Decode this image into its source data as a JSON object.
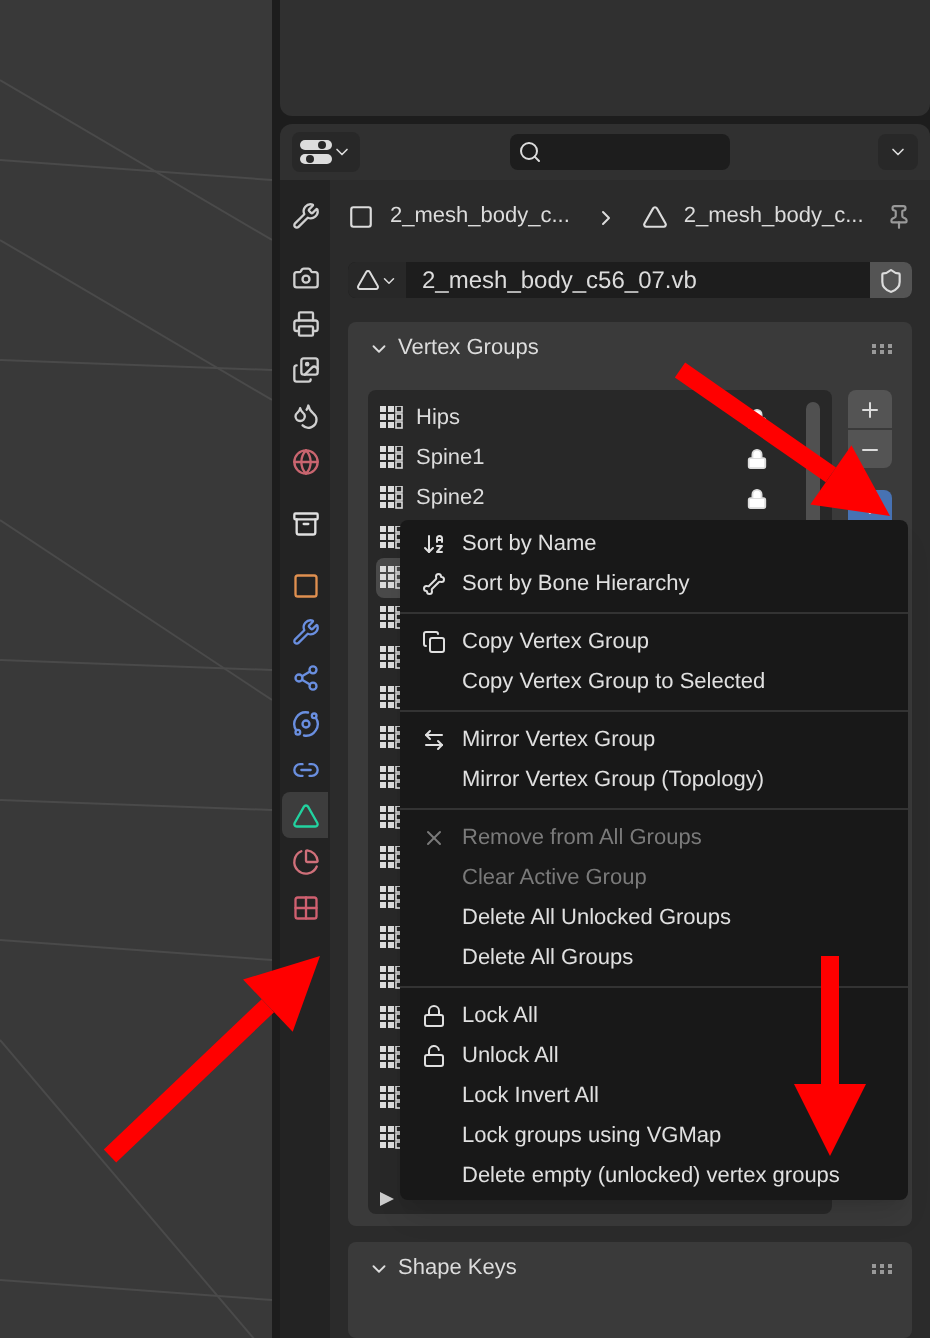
{
  "tabs": [
    {
      "kind": "tool",
      "selected": false
    },
    {
      "kind": "render",
      "selected": false
    },
    {
      "kind": "output",
      "selected": false
    },
    {
      "kind": "view_layer",
      "selected": false
    },
    {
      "kind": "scene",
      "selected": false
    },
    {
      "kind": "world",
      "selected": false
    },
    {
      "kind": "collection",
      "selected": false
    },
    {
      "kind": "object",
      "selected": false
    },
    {
      "kind": "modifiers",
      "selected": false
    },
    {
      "kind": "particles",
      "selected": false
    },
    {
      "kind": "physics",
      "selected": false
    },
    {
      "kind": "constraints",
      "selected": false
    },
    {
      "kind": "data",
      "selected": true
    },
    {
      "kind": "material",
      "selected": false
    },
    {
      "kind": "texture",
      "selected": false
    }
  ],
  "breadcrumb": [
    {
      "kind": "object",
      "label": "2_mesh_body_c..."
    },
    {
      "kind": "mesh",
      "label": "2_mesh_body_c..."
    }
  ],
  "mesh_name": "2_mesh_body_c56_07.vb",
  "vertex_groups": {
    "title": "Vertex Groups",
    "items": [
      {
        "name": "Hips",
        "locked": true
      },
      {
        "name": "Spine1",
        "locked": true
      },
      {
        "name": "Spine2",
        "locked": true
      }
    ],
    "covered_rows": [
      {
        "selected": false
      },
      {
        "selected": true
      },
      {
        "selected": false
      },
      {
        "selected": false
      },
      {
        "selected": false
      },
      {
        "selected": false
      },
      {
        "selected": false
      },
      {
        "selected": false
      },
      {
        "selected": false
      },
      {
        "selected": false
      },
      {
        "selected": false
      },
      {
        "selected": false
      },
      {
        "selected": false
      },
      {
        "selected": false
      },
      {
        "selected": false
      },
      {
        "selected": false
      }
    ],
    "menu": [
      [
        {
          "label": "Sort by Name",
          "disabled": false
        },
        {
          "label": "Sort by Bone Hierarchy",
          "disabled": false
        }
      ],
      [
        {
          "label": "Copy Vertex Group",
          "disabled": false
        },
        {
          "label": "Copy Vertex Group to Selected",
          "disabled": false
        }
      ],
      [
        {
          "label": "Mirror Vertex Group",
          "disabled": false
        },
        {
          "label": "Mirror Vertex Group (Topology)",
          "disabled": false
        }
      ],
      [
        {
          "label": "Remove from All Groups",
          "disabled": true
        },
        {
          "label": "Clear Active Group",
          "disabled": true
        },
        {
          "label": "Delete All Unlocked Groups",
          "disabled": false
        },
        {
          "label": "Delete All Groups",
          "disabled": false
        }
      ],
      [
        {
          "label": "Lock All",
          "disabled": false
        },
        {
          "label": "Unlock All",
          "disabled": false
        },
        {
          "label": "Lock Invert All",
          "disabled": false
        },
        {
          "label": "Lock groups using VGMap",
          "disabled": false
        },
        {
          "label": "Delete empty (unlocked) vertex groups",
          "disabled": false
        }
      ]
    ]
  },
  "shape_keys": {
    "title": "Shape Keys"
  }
}
